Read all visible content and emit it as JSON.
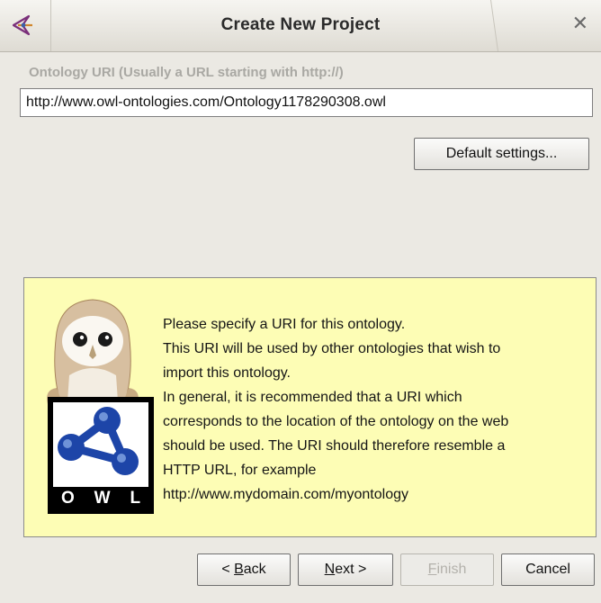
{
  "window": {
    "title": "Create New Project",
    "icon": "protege-icon"
  },
  "uri": {
    "label": "Ontology URI (Usually a URL starting with http://)",
    "value": "http://www.owl-ontologies.com/Ontology1178290308.owl"
  },
  "default_settings_label": "Default settings...",
  "info": {
    "lines": [
      "Please specify a URI for this ontology.",
      "This URI will be used by other ontologies that wish to",
      "import this ontology.",
      "In general, it is recommended that a URI which",
      "corresponds to the location of the ontology on the web",
      "should be used. The URI should therefore resemble a",
      "HTTP URL, for example",
      "http://www.mydomain.com/myontology"
    ],
    "logo_letters": [
      "O",
      "W",
      "L"
    ],
    "colors": {
      "panel": "#fdfdb5",
      "logo_blue": "#1d45a8"
    }
  },
  "buttons": {
    "back": {
      "pre": "< ",
      "mnemonic": "B",
      "rest": "ack"
    },
    "next": {
      "mnemonic": "N",
      "rest": "ext >"
    },
    "finish": {
      "mnemonic": "F",
      "rest": "inish",
      "enabled": false
    },
    "cancel": "Cancel"
  }
}
